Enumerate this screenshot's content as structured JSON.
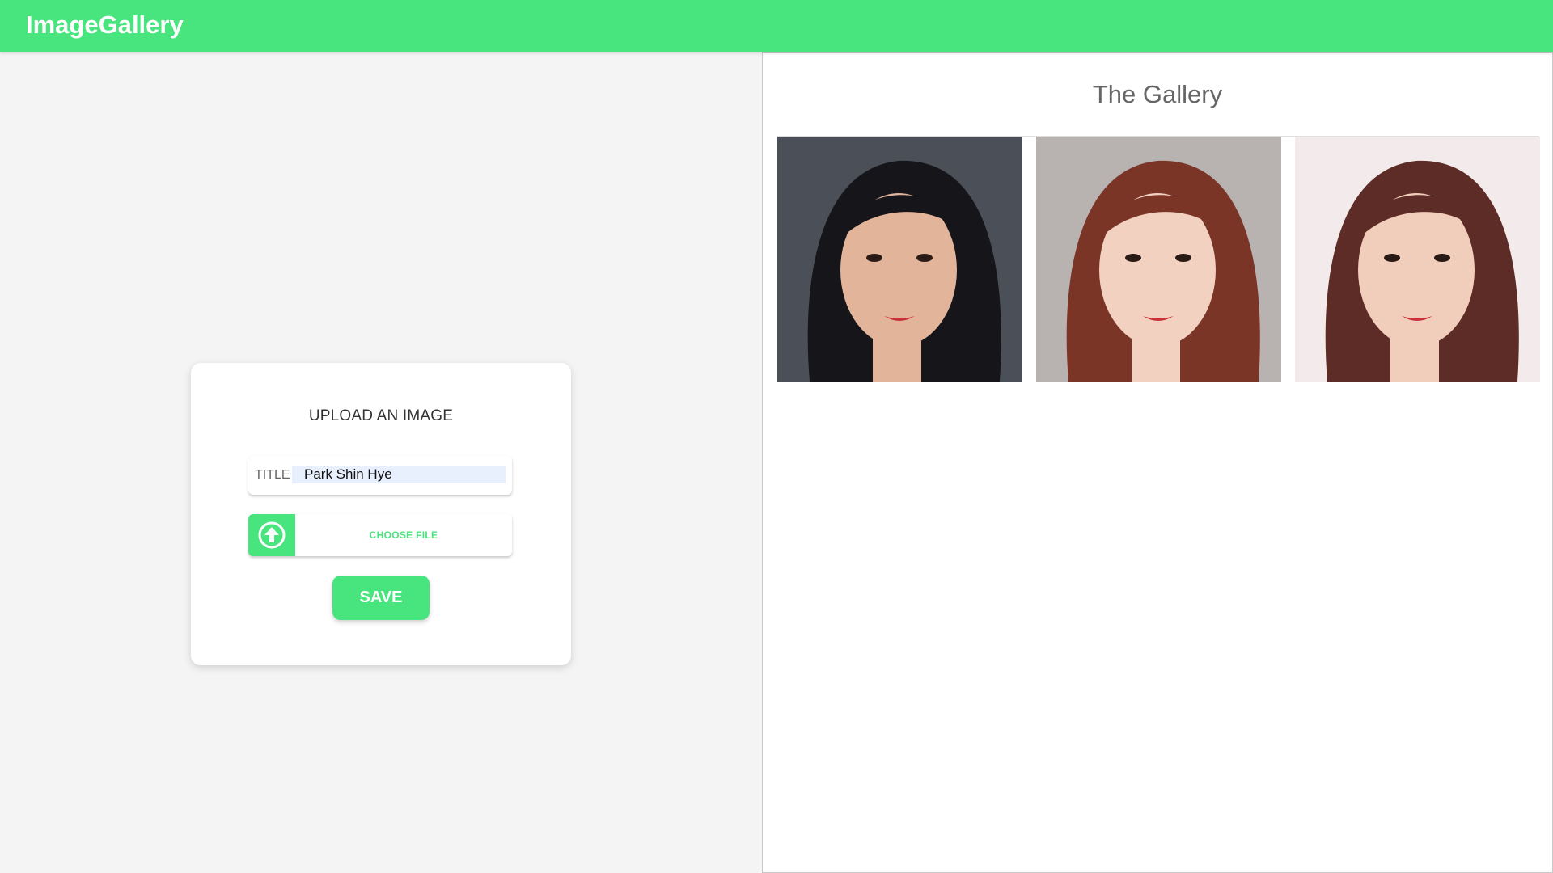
{
  "app": {
    "brand": "ImageGallery",
    "accent_color": "#48e57e"
  },
  "upload": {
    "heading": "UPLOAD AN IMAGE",
    "title_label": "TITLE",
    "title_value": "Park Shin Hye",
    "choose_file_label": "CHOOSE FILE",
    "upload_icon": "upload-arrow-circle-icon",
    "save_label": "SAVE"
  },
  "gallery": {
    "heading": "The Gallery",
    "photos": [
      {
        "icon": "portrait-photo",
        "background": "#4b4f58",
        "hair": "#15151a",
        "skin": "#e2b49a"
      },
      {
        "icon": "portrait-photo",
        "background": "#b8b2b1",
        "hair": "#7a3527",
        "skin": "#f2d1c1"
      },
      {
        "icon": "portrait-photo",
        "background": "#f3ebeb",
        "hair": "#5e2c26",
        "skin": "#f1cdbb"
      }
    ]
  }
}
